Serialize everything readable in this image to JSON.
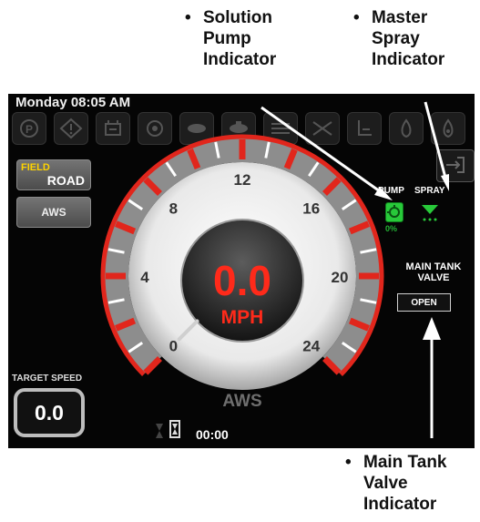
{
  "callouts": {
    "pump": [
      "Solution",
      "Pump",
      "Indicator"
    ],
    "spray": [
      "Master",
      "Spray",
      "Indicator"
    ],
    "valve": [
      "Main Tank",
      "Valve",
      "Indicator"
    ],
    "bullet": "•"
  },
  "status": {
    "datetime": "Monday 08:05 AM"
  },
  "mode": {
    "field": "FIELD",
    "road": "ROAD",
    "aws": "AWS"
  },
  "target_speed": {
    "label": "TARGET SPEED",
    "value": "0.0"
  },
  "speedometer": {
    "speed": "0.0",
    "unit": "MPH",
    "steering_mode": "AWS",
    "ticks": [
      "0",
      "4",
      "8",
      "12",
      "16",
      "20",
      "24"
    ],
    "speed_value": 0,
    "max_value": 24
  },
  "timer": {
    "value": "00:00"
  },
  "indicators": {
    "pump_label": "PUMP",
    "spray_label": "SPRAY",
    "pump_percent": "0%",
    "main_tank_label": "MAIN TANK VALVE",
    "valve_state": "OPEN"
  },
  "top_icons": [
    "parking-brake-icon",
    "warning-icon",
    "hydraulic-icon",
    "engine-icon",
    "axle-icon",
    "pump-icon",
    "boom-icon",
    "boom-fold-icon",
    "operator-icon",
    "tank-icon",
    "fuel-icon"
  ],
  "colors": {
    "gauge_red": "#e1261c",
    "readout_red": "#ff2a1a",
    "pump_green": "#28c93a",
    "field_yellow": "#ffd400"
  }
}
